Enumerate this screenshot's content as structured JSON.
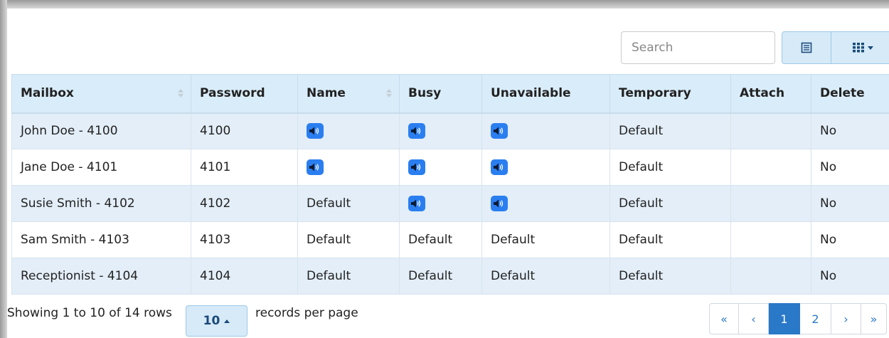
{
  "toolbar": {
    "search_placeholder": "Search",
    "view_icon": "list-view-icon",
    "columns_icon": "grid-columns-icon"
  },
  "table": {
    "headers": [
      "Mailbox",
      "Password",
      "Name",
      "Busy",
      "Unavailable",
      "Temporary",
      "Attach",
      "Delete"
    ],
    "sortable": [
      "Mailbox",
      "Name"
    ],
    "rows": [
      {
        "mailbox": "John Doe - 4100",
        "password": "4100",
        "name": "audio",
        "busy": "audio",
        "unavailable": "audio",
        "temporary": "Default",
        "attach": "",
        "delete": "No"
      },
      {
        "mailbox": "Jane Doe - 4101",
        "password": "4101",
        "name": "audio",
        "busy": "audio",
        "unavailable": "audio",
        "temporary": "Default",
        "attach": "",
        "delete": "No"
      },
      {
        "mailbox": "Susie Smith - 4102",
        "password": "4102",
        "name": "Default",
        "busy": "audio",
        "unavailable": "audio",
        "temporary": "Default",
        "attach": "",
        "delete": "No"
      },
      {
        "mailbox": "Sam Smith - 4103",
        "password": "4103",
        "name": "Default",
        "busy": "Default",
        "unavailable": "Default",
        "temporary": "Default",
        "attach": "",
        "delete": "No"
      },
      {
        "mailbox": "Receptionist - 4104",
        "password": "4104",
        "name": "Default",
        "busy": "Default",
        "unavailable": "Default",
        "temporary": "Default",
        "attach": "",
        "delete": "No"
      }
    ]
  },
  "footer": {
    "showing": "Showing 1 to 10 of 14 rows",
    "page_size": "10",
    "records_per_page": "records per page",
    "pagination": {
      "first": "«",
      "prev": "‹",
      "pages": [
        "1",
        "2"
      ],
      "active": "1",
      "next": "›",
      "last": "»"
    }
  },
  "colors": {
    "header_bg": "#d9ecf9",
    "odd_row_bg": "#e3eef8",
    "audio_button": "#2a7ef0",
    "accent": "#2a78c8"
  }
}
